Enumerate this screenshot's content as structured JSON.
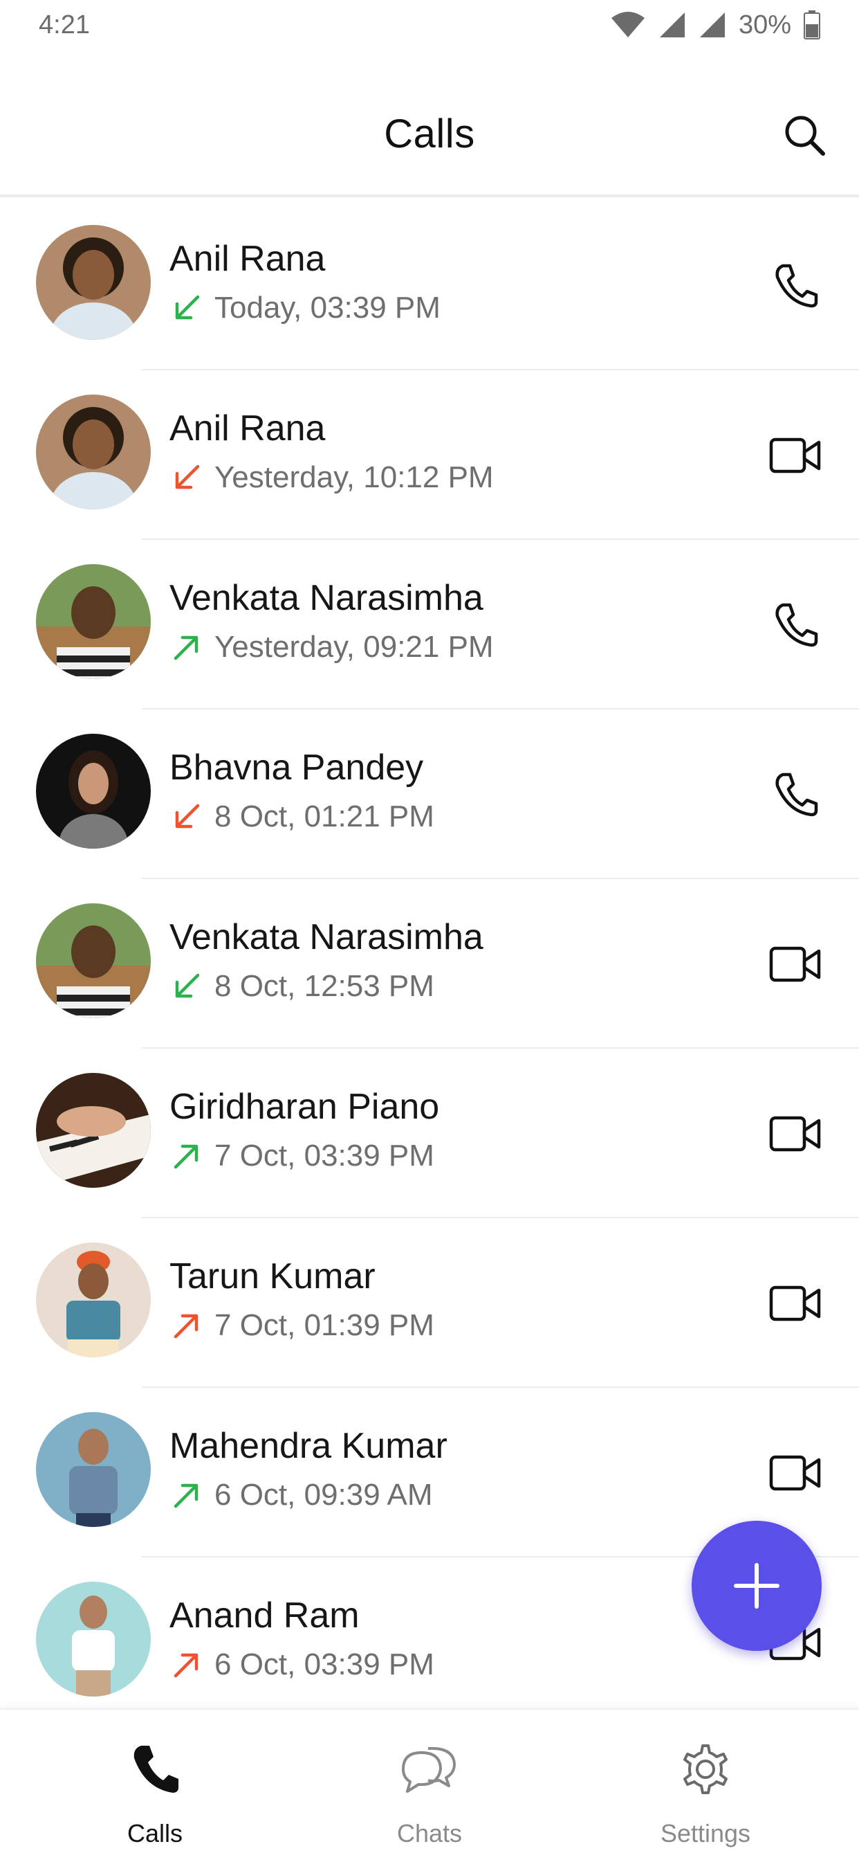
{
  "status_bar": {
    "time": "4:21",
    "battery": "30%"
  },
  "header": {
    "title": "Calls"
  },
  "calls": [
    {
      "name": "Anil Rana",
      "time": "Today, 03:39 PM",
      "direction": "incoming",
      "type": "voice"
    },
    {
      "name": "Anil Rana",
      "time": "Yesterday, 10:12 PM",
      "direction": "missed",
      "type": "video"
    },
    {
      "name": "Venkata Narasimha",
      "time": "Yesterday, 09:21 PM",
      "direction": "outgoing",
      "type": "voice"
    },
    {
      "name": "Bhavna Pandey",
      "time": "8 Oct, 01:21 PM",
      "direction": "missed",
      "type": "voice"
    },
    {
      "name": "Venkata Narasimha",
      "time": "8 Oct, 12:53 PM",
      "direction": "incoming",
      "type": "video"
    },
    {
      "name": "Giridharan Piano",
      "time": "7 Oct, 03:39 PM",
      "direction": "outgoing",
      "type": "video"
    },
    {
      "name": "Tarun Kumar",
      "time": "7 Oct, 01:39 PM",
      "direction": "outgoing-unanswered",
      "type": "video"
    },
    {
      "name": "Mahendra Kumar",
      "time": "6 Oct, 09:39 AM",
      "direction": "outgoing",
      "type": "video"
    },
    {
      "name": "Anand Ram",
      "time": "6 Oct, 03:39 PM",
      "direction": "outgoing-unanswered",
      "type": "video"
    }
  ],
  "colors": {
    "green": "#2bb24c",
    "red": "#f0522f",
    "accent": "#5b4fe9"
  },
  "nav": {
    "calls_label": "Calls",
    "chats_label": "Chats",
    "settings_label": "Settings"
  }
}
